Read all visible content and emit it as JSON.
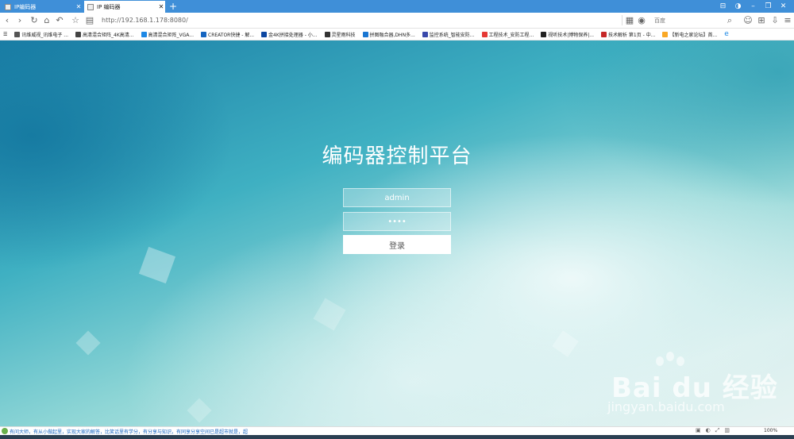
{
  "browser": {
    "tabs": [
      {
        "title": "IP编码器",
        "active": false
      },
      {
        "title": "IP 编码器",
        "active": true
      }
    ],
    "new_tab": "+",
    "url": "http://192.168.1.178:8080/",
    "search_placeholder": "百度",
    "zoom": "100%"
  },
  "bookmarks": [
    {
      "label": "讯维威视_讯维电子 ...",
      "color": "#555"
    },
    {
      "label": "高清混合矩阵_4K高清...",
      "color": "#444"
    },
    {
      "label": "高清混合矩阵_VGA...",
      "color": "#1e88e5"
    },
    {
      "label": "CREATOR快捷 - 解...",
      "color": "#1565c0"
    },
    {
      "label": "金4K拼接处理器 - 小...",
      "color": "#0d47a1"
    },
    {
      "label": "灵星雨科技",
      "color": "#333"
    },
    {
      "label": "拼图融合器,DHN多...",
      "color": "#1976d2"
    },
    {
      "label": "监控系统_智能安防...",
      "color": "#3949ab"
    },
    {
      "label": "工程技术_安防工程...",
      "color": "#e53935"
    },
    {
      "label": "视听技术|博物保养|...",
      "color": "#222"
    },
    {
      "label": "技术解析 第1页 - 中...",
      "color": "#c62828"
    },
    {
      "label": "【新电之家论坛】首...",
      "color": "#f9a825"
    }
  ],
  "login": {
    "title": "编码器控制平台",
    "username": "admin",
    "password": "••••",
    "button": "登录"
  },
  "watermark": {
    "brand": "Bai du 经验",
    "url": "jingyan.baidu.com"
  },
  "status": {
    "text": "有问大师，有从小做起里，实现大家的解答，比笑话里有学分，有分享与知识，有同享分享空间已是超市就是，超"
  }
}
